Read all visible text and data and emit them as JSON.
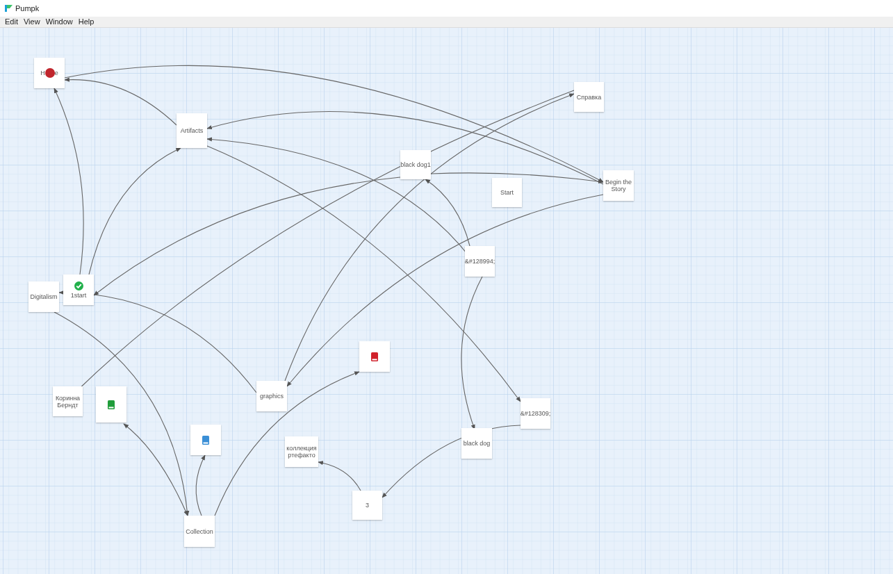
{
  "app": {
    "title": "Pumpk"
  },
  "menu": [
    {
      "label": "Edit"
    },
    {
      "label": "View"
    },
    {
      "label": "Window"
    },
    {
      "label": "Help"
    }
  ],
  "nodes": [
    {
      "label_parts": [
        "H",
        "e"
      ],
      "icon": {
        "kind": "dot",
        "color": "#c0262d"
      }
    },
    {
      "label": "Справка"
    },
    {
      "label": "Artifacts"
    },
    {
      "label": "black dog1"
    },
    {
      "label": "Begin the Story"
    },
    {
      "label": "Start"
    },
    {
      "label": "&#128994;"
    },
    {
      "label": "1start",
      "icon": {
        "kind": "check",
        "color": "#22b04b"
      }
    },
    {
      "label": "Digitalism"
    },
    {
      "icon": {
        "kind": "book",
        "color": "#d0212b"
      }
    },
    {
      "label": "graphics"
    },
    {
      "label": "Коринна Берндт"
    },
    {
      "icon": {
        "kind": "book",
        "color": "#1f9d3a"
      }
    },
    {
      "label": "&#128309;"
    },
    {
      "icon": {
        "kind": "book",
        "color": "#3a8fd6"
      }
    },
    {
      "label": "black dog"
    },
    {
      "label": "коллекция ртефакто"
    },
    {
      "label": "3"
    },
    {
      "label": "Collection"
    }
  ]
}
